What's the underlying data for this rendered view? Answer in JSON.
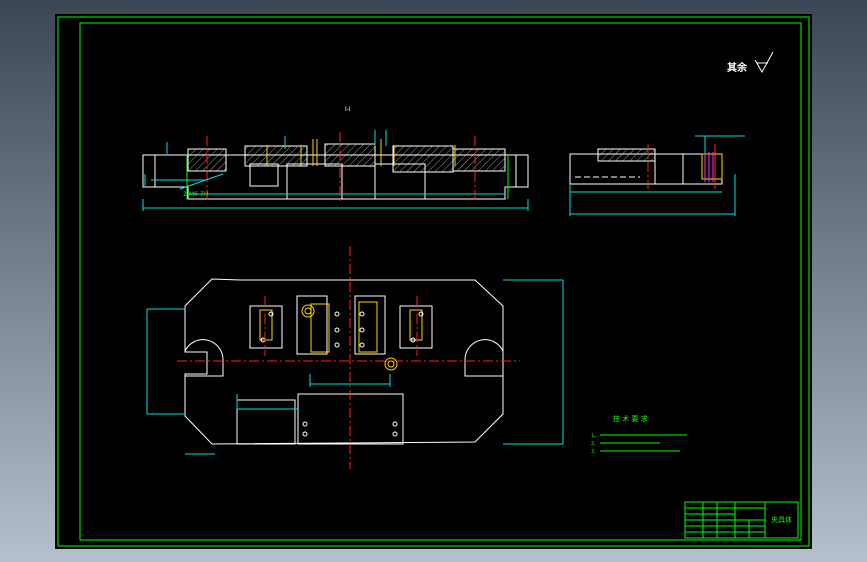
{
  "drawing": {
    "surface_label": "其余",
    "section_label": "I-I",
    "callout_hole": "2-M6-7H",
    "tech_title": "技 术 要 求",
    "tech_notes": [
      "1.",
      "2.",
      "3."
    ],
    "title_block_name": "夹具体",
    "colors": {
      "background": "#000000",
      "outline": "#00ff00",
      "object": "#ffffff",
      "center": "#ff2020",
      "dimension": "#00e0e0"
    }
  }
}
